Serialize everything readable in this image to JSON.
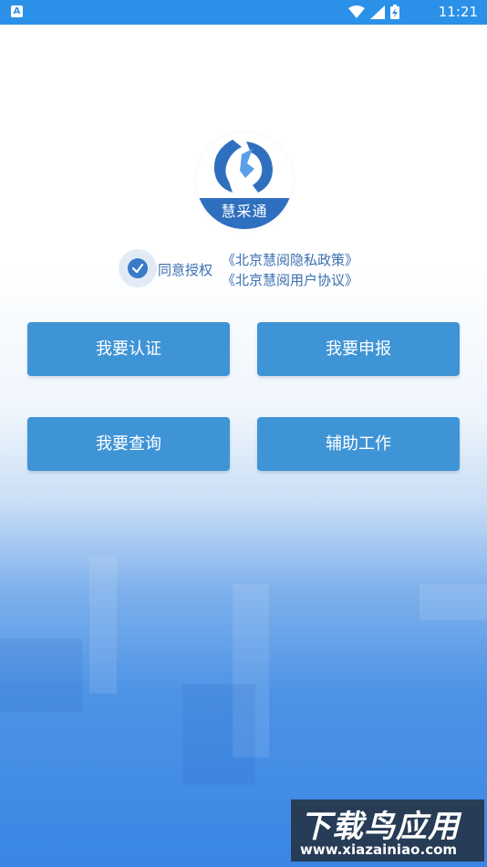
{
  "status_bar": {
    "app_icon_letter": "A",
    "time": "11:21"
  },
  "logo": {
    "text": "慧采通"
  },
  "agreement": {
    "label": "同意授权",
    "privacy_link": "《北京慧阅隐私政策》",
    "user_link": "《北京慧阅用户协议》"
  },
  "buttons": {
    "certify": "我要认证",
    "report": "我要申报",
    "query": "我要查询",
    "assist": "辅助工作"
  },
  "watermark": {
    "title": "下载鸟应用",
    "url": "www.xiazainiao.com"
  },
  "colors": {
    "status_bar": "#2b91e8",
    "button": "#3f94d6",
    "link": "#3b6fb0",
    "check": "#3b79c9"
  }
}
